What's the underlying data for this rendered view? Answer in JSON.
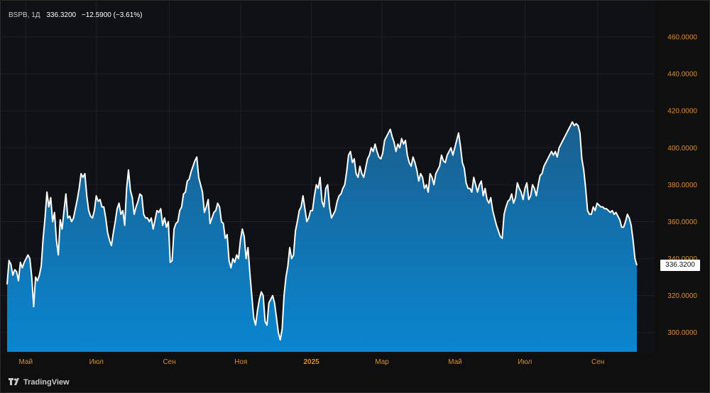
{
  "header": {
    "symbol": "BSPB, 1Д",
    "last_price": "336.3200",
    "change": "−12.5900 (−3.61%)"
  },
  "price_tag": "336.3200",
  "logo_text": "TradingView",
  "colors": {
    "line": "#ffffff",
    "fill_top": "#1a5f8e",
    "fill_bottom": "#0a86d0",
    "axis_text": "#d98f2e",
    "grid": "#1d2128"
  },
  "chart_data": {
    "type": "area",
    "title": "",
    "xlabel": "",
    "ylabel": "",
    "ylim": [
      288,
      470
    ],
    "y_ticks": [
      "460.0000",
      "440.0000",
      "420.0000",
      "400.0000",
      "380.0000",
      "360.0000",
      "340.0000",
      "320.0000",
      "300.0000"
    ],
    "x_ticks": [
      {
        "label": "Май",
        "t": 23
      },
      {
        "label": "Июл",
        "t": 110
      },
      {
        "label": "Сен",
        "t": 200
      },
      {
        "label": "Ноя",
        "t": 288
      },
      {
        "label": "2025",
        "t": 375,
        "bold": true
      },
      {
        "label": "Мар",
        "t": 462
      },
      {
        "label": "Май",
        "t": 552
      },
      {
        "label": "Июл",
        "t": 638
      },
      {
        "label": "Сен",
        "t": 728
      }
    ],
    "x_range": [
      0,
      776
    ],
    "series": [
      {
        "values": [
          326,
          339,
          337,
          331,
          334,
          333,
          328,
          338,
          335,
          338,
          340,
          342,
          340,
          330,
          314,
          330,
          328,
          331,
          336,
          351,
          362,
          376,
          368,
          373,
          360,
          365,
          350,
          342,
          361,
          356,
          366,
          375,
          362,
          363,
          360,
          362,
          367,
          372,
          378,
          386,
          384,
          386,
          374,
          366,
          363,
          362,
          366,
          374,
          371,
          372,
          368,
          368,
          362,
          354,
          350,
          347,
          354,
          360,
          367,
          370,
          364,
          366,
          358,
          378,
          388,
          377,
          373,
          364,
          368,
          371,
          375,
          374,
          364,
          362,
          362,
          360,
          362,
          356,
          361,
          366,
          365,
          367,
          358,
          362,
          357,
          360,
          338,
          339,
          356,
          359,
          360,
          366,
          368,
          375,
          376,
          382,
          383,
          387,
          390,
          393,
          395,
          384,
          380,
          376,
          365,
          368,
          372,
          359,
          362,
          365,
          366,
          370,
          368,
          360,
          359,
          351,
          353,
          339,
          335,
          340,
          338,
          342,
          340,
          350,
          356,
          352,
          340,
          346,
          332,
          320,
          308,
          304,
          312,
          318,
          322,
          320,
          306,
          304,
          316,
          318,
          320,
          316,
          308,
          300,
          296,
          302,
          320,
          330,
          336,
          346,
          340,
          342,
          355,
          360,
          366,
          368,
          374,
          367,
          360,
          362,
          366,
          366,
          374,
          380,
          378,
          384,
          371,
          368,
          378,
          380,
          368,
          362,
          364,
          366,
          371,
          374,
          375,
          378,
          380,
          387,
          396,
          398,
          392,
          394,
          386,
          384,
          390,
          386,
          384,
          389,
          394,
          396,
          400,
          398,
          402,
          398,
          395,
          394,
          397,
          404,
          406,
          408,
          410,
          406,
          403,
          398,
          402,
          400,
          405,
          402,
          404,
          396,
          392,
          390,
          395,
          392,
          388,
          382,
          386,
          384,
          378,
          380,
          376,
          386,
          384,
          380,
          386,
          388,
          390,
          396,
          393,
          392,
          396,
          398,
          400,
          396,
          400,
          404,
          408,
          401,
          392,
          389,
          381,
          378,
          378,
          376,
          384,
          380,
          376,
          380,
          382,
          374,
          378,
          372,
          370,
          373,
          366,
          362,
          358,
          355,
          352,
          351,
          364,
          368,
          371,
          372,
          375,
          370,
          373,
          381,
          378,
          376,
          372,
          378,
          381,
          372,
          374,
          380,
          378,
          374,
          380,
          385,
          386,
          390,
          392,
          394,
          396,
          398,
          396,
          398,
          395,
          400,
          402,
          404,
          406,
          408,
          410,
          412,
          414,
          412,
          413,
          412,
          408,
          394,
          388,
          378,
          366,
          364,
          364,
          368,
          366,
          370,
          369,
          368,
          368,
          367,
          367,
          366,
          365,
          366,
          364,
          365,
          363,
          361,
          357,
          357,
          360,
          364,
          362,
          358,
          350,
          340,
          336.32
        ]
      }
    ]
  }
}
